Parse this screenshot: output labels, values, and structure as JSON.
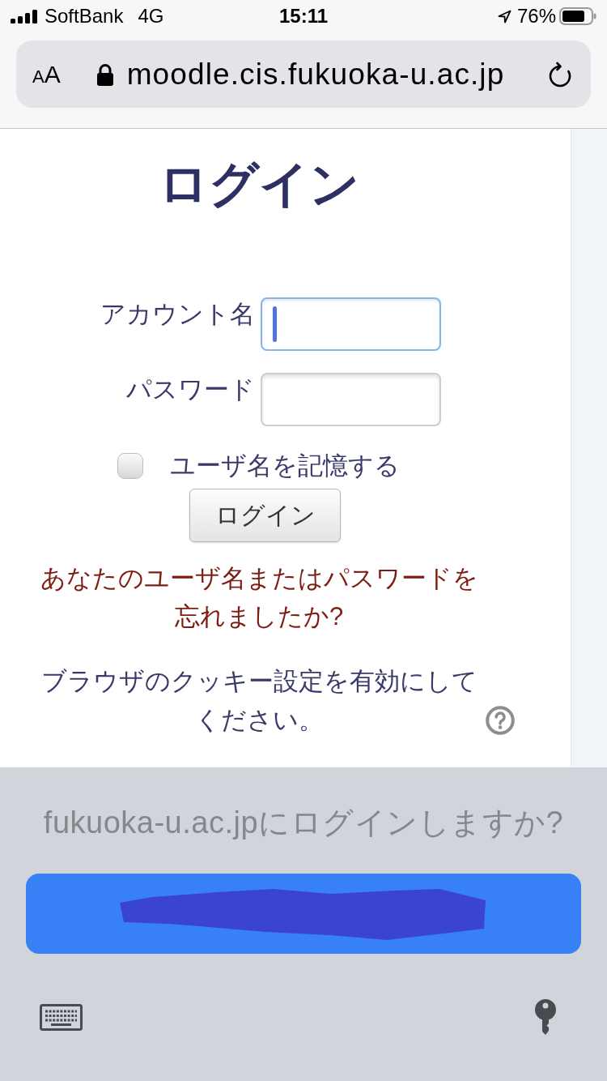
{
  "status_bar": {
    "carrier": "SoftBank",
    "network": "4G",
    "time": "15:11",
    "battery": "76%"
  },
  "address_bar": {
    "text_size_label": "AA",
    "url": "moodle.cis.fukuoka-u.ac.jp"
  },
  "login_form": {
    "heading": "ログイン",
    "fields": [
      {
        "label": "アカウント名",
        "focused": true
      },
      {
        "label": "パスワード",
        "focused": false
      }
    ],
    "remember_username": {
      "label": "ユーザ名を記憶する",
      "checked": false
    },
    "login_button": "ログイン",
    "forgot_link": "あなたのユーザ名またはパスワードを忘れましたか?",
    "cookie_notice": "ブラウザのクッキー設定を有効にしてください。"
  },
  "password_prompt": {
    "title": "fukuoka-u.ac.jpにログインしますか?"
  }
}
